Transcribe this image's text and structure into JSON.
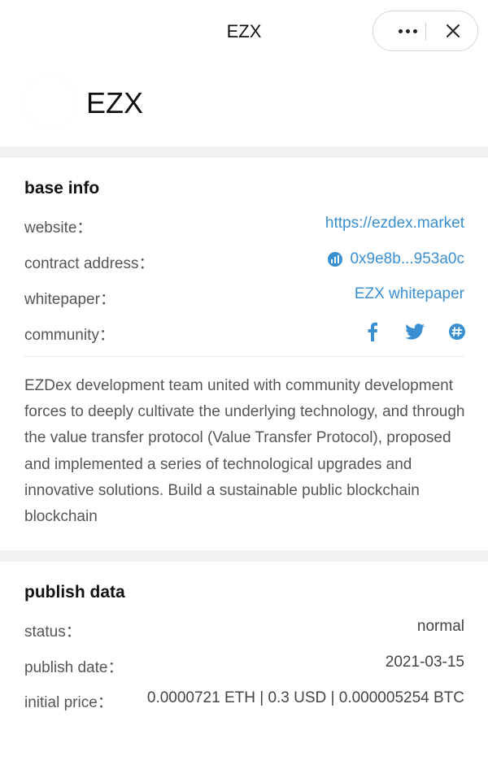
{
  "topbar": {
    "title": "EZX"
  },
  "header": {
    "token_name": "EZX"
  },
  "base_info": {
    "title": "base info",
    "website": {
      "label": "website：",
      "value": "https://ezdex.market"
    },
    "contract": {
      "label": "contract address：",
      "value": "0x9e8b...953a0c"
    },
    "whitepaper": {
      "label": "whitepaper：",
      "value": "EZX whitepaper"
    },
    "community": {
      "label": "community：",
      "icons": [
        "facebook-icon",
        "twitter-icon",
        "discord-icon"
      ]
    },
    "description": "EZDex development team united with community development forces to deeply cultivate the underlying technology, and through the value transfer protocol (Value Transfer Protocol), proposed and implemented a series of technological upgrades and innovative solutions. Build a sustainable public blockchain blockchain"
  },
  "publish_data": {
    "title": "publish data",
    "status": {
      "label": "status：",
      "value": "normal"
    },
    "publish_date": {
      "label": "publish date：",
      "value": "2021-03-15"
    },
    "initial_price": {
      "label": "initial price：",
      "value": "0.0000721 ETH | 0.3 USD | 0.000005254 BTC"
    }
  },
  "colors": {
    "link": "#3a8fd1",
    "divider": "#f1f1f1",
    "text": "#555555",
    "title": "#111111"
  }
}
